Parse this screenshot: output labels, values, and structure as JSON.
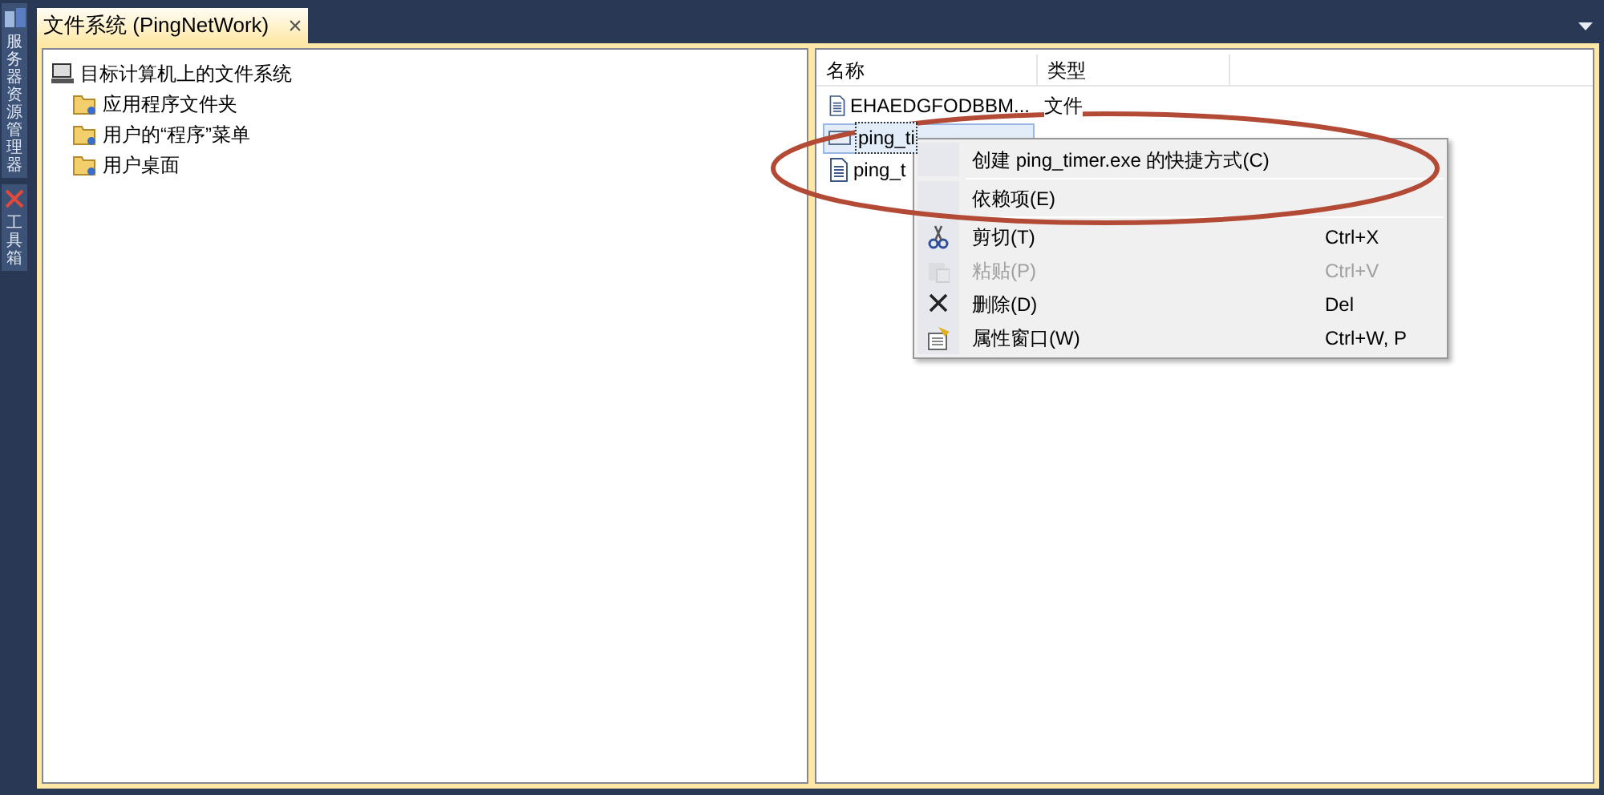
{
  "side_tabs": [
    {
      "label": "服务器资源管理器"
    },
    {
      "label": "工具箱"
    }
  ],
  "tabs": [
    {
      "label": "文件系统 (PingNetWork)",
      "selected": true,
      "close": "×"
    }
  ],
  "tree": {
    "label": "目标计算机上的文件系统",
    "children": [
      {
        "label": "应用程序文件夹"
      },
      {
        "label": "用户的“程序”菜单"
      },
      {
        "label": "用户桌面"
      }
    ]
  },
  "list": {
    "columns": [
      "名称",
      "类型"
    ],
    "rows": [
      {
        "name": "EHAEDGFODBBM...",
        "type": "文件",
        "kind": "file",
        "selected": false
      },
      {
        "name": "ping_ti",
        "kind": "assembly",
        "selected": true
      },
      {
        "name": "ping_t",
        "kind": "file",
        "selected": false
      }
    ]
  },
  "context_menu": [
    {
      "kind": "item",
      "label": "创建 ping_timer.exe 的快捷方式(C)",
      "disabled": false
    },
    {
      "kind": "separator"
    },
    {
      "kind": "item",
      "label": "依赖项(E)",
      "disabled": false
    },
    {
      "kind": "separator"
    },
    {
      "kind": "cut",
      "label": "剪切(T)",
      "shortcut": "Ctrl+X",
      "disabled": false
    },
    {
      "kind": "paste",
      "label": "粘贴(P)",
      "shortcut": "Ctrl+V",
      "disabled": true
    },
    {
      "kind": "delete",
      "label": "删除(D)",
      "shortcut": "Del",
      "disabled": false
    },
    {
      "kind": "properties",
      "label": "属性窗口(W)",
      "shortcut": "Ctrl+W, P",
      "disabled": false
    }
  ]
}
